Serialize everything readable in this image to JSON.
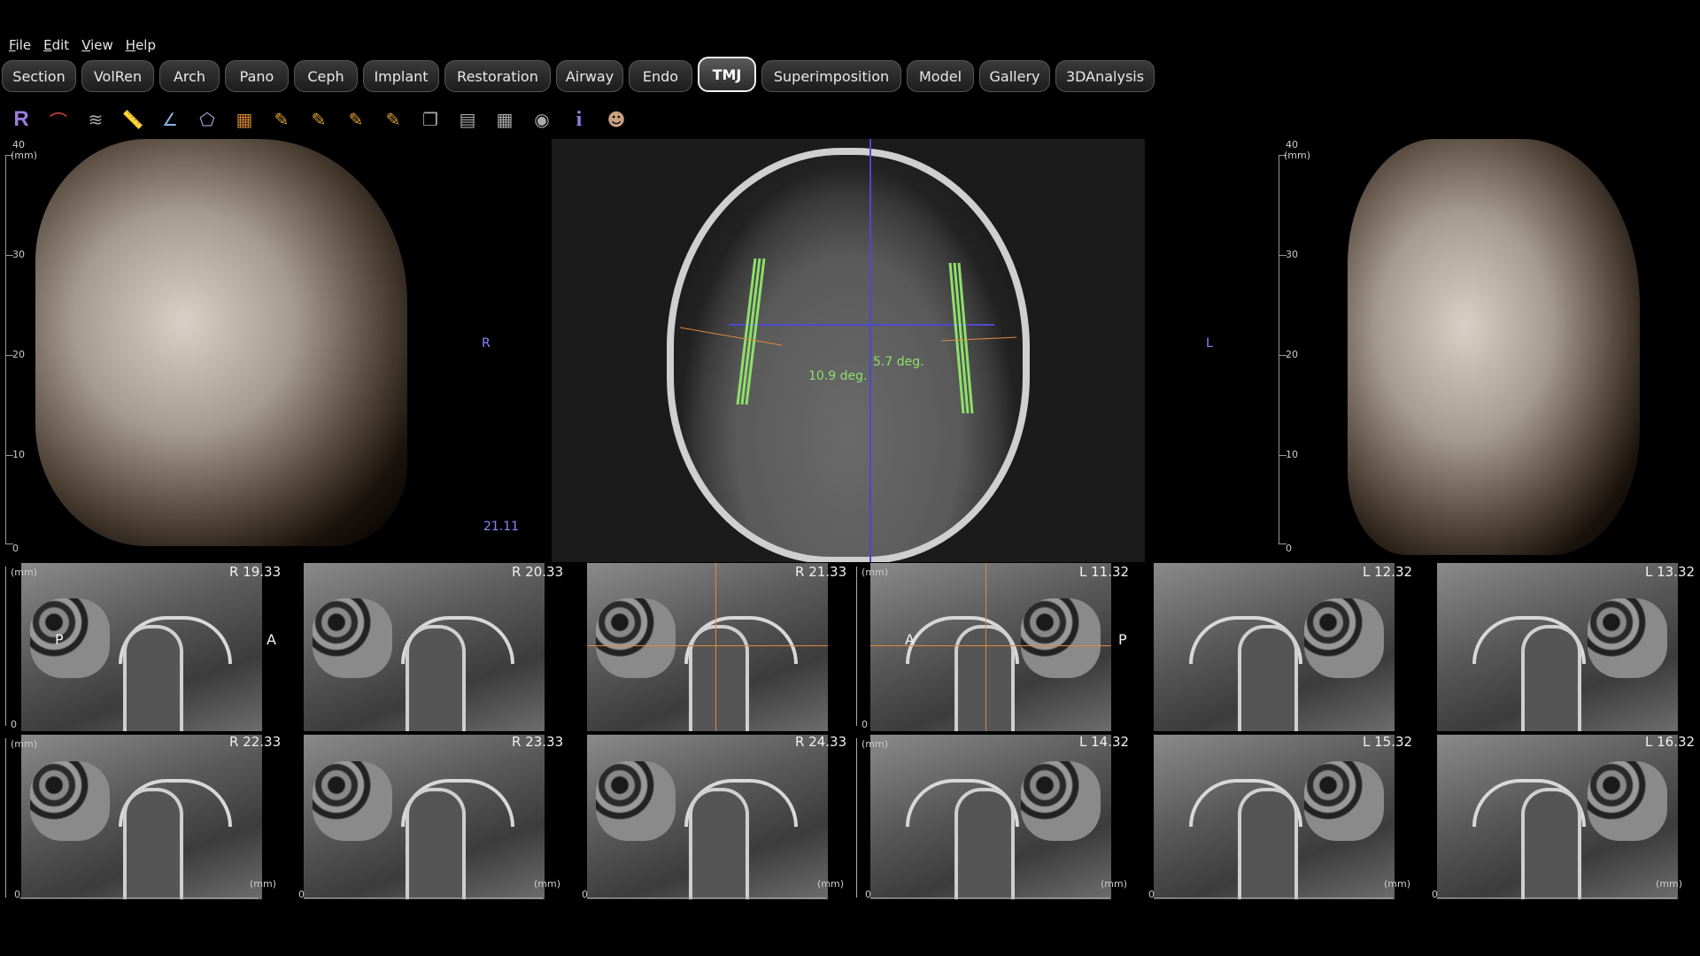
{
  "menu": [
    "File",
    "Edit",
    "View",
    "Help"
  ],
  "tabs": [
    {
      "label": "Section",
      "active": false
    },
    {
      "label": "VolRen",
      "active": false
    },
    {
      "label": "Arch",
      "active": false
    },
    {
      "label": "Pano",
      "active": false
    },
    {
      "label": "Ceph",
      "active": false
    },
    {
      "label": "Implant",
      "active": false
    },
    {
      "label": "Restoration",
      "active": false
    },
    {
      "label": "Airway",
      "active": false
    },
    {
      "label": "Endo",
      "active": false
    },
    {
      "label": "TMJ",
      "active": true
    },
    {
      "label": "Superimposition",
      "active": false
    },
    {
      "label": "Model",
      "active": false
    },
    {
      "label": "Gallery",
      "active": false
    },
    {
      "label": "3DAnalysis",
      "active": false
    }
  ],
  "toolbar_icons": [
    {
      "name": "reset-icon",
      "glyph": "R"
    },
    {
      "name": "arch-icon",
      "glyph": "⌒"
    },
    {
      "name": "nerve-icon",
      "glyph": "≋"
    },
    {
      "name": "ruler-icon",
      "glyph": "📏"
    },
    {
      "name": "angle-measure-icon",
      "glyph": "∠"
    },
    {
      "name": "area-icon",
      "glyph": "⬠"
    },
    {
      "name": "palette-icon",
      "glyph": "▦"
    },
    {
      "name": "pencil-line-icon",
      "glyph": "✎"
    },
    {
      "name": "pencil-circle-icon",
      "glyph": "✎"
    },
    {
      "name": "pencil-text-icon",
      "glyph": "✎"
    },
    {
      "name": "pencil-hu-icon",
      "glyph": "✎"
    },
    {
      "name": "copy-icon",
      "glyph": "❐"
    },
    {
      "name": "layout-icon",
      "glyph": "▤"
    },
    {
      "name": "grid-icon",
      "glyph": "▦"
    },
    {
      "name": "eye-icon",
      "glyph": "◉"
    },
    {
      "name": "info-icon",
      "glyph": "i"
    },
    {
      "name": "capture-icon",
      "glyph": "☻"
    }
  ],
  "left3d": {
    "ruler_top": "40",
    "unit": "(mm)",
    "ticks": [
      "30",
      "20",
      "10",
      "0"
    ],
    "side": "R",
    "value": "21.11"
  },
  "right3d": {
    "ruler_top": "40",
    "unit": "(mm)",
    "ticks": [
      "30",
      "20",
      "10",
      "0"
    ],
    "side": "L"
  },
  "axial": {
    "left_angle": "10.9 deg.",
    "right_angle": "5.7 deg."
  },
  "slices_row1": [
    "R 19.33",
    "R 20.33",
    "R 21.33",
    "L 11.32",
    "L 12.32",
    "L 13.32"
  ],
  "slices_row2": [
    "R 22.33",
    "R 23.33",
    "R 24.33",
    "L 14.32",
    "L 15.32",
    "L 16.32"
  ],
  "orient": {
    "p": "P",
    "a": "A"
  },
  "mm": "(mm)",
  "zero": "0"
}
